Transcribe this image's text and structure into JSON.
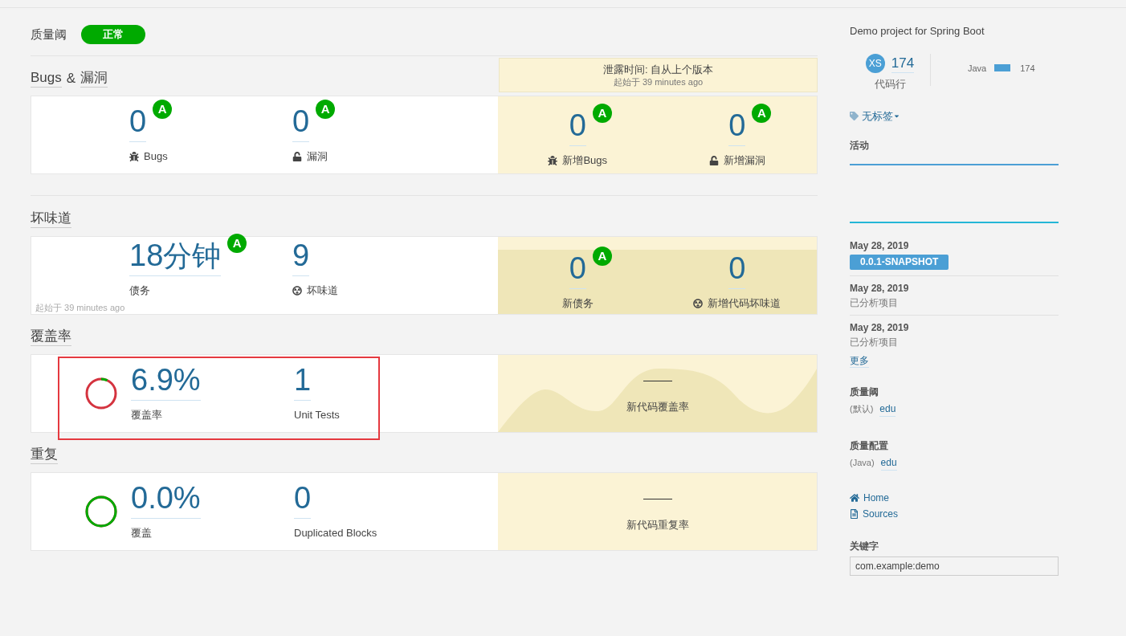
{
  "quality_gate": {
    "title": "质量阈",
    "status": "正常",
    "passed": true
  },
  "sections": [
    {
      "kind": "issues",
      "highlighted": false,
      "title": [
        {
          "text": "Bugs",
          "link": true
        },
        {
          "text": "&",
          "link": false
        },
        {
          "text": "漏洞",
          "link": true
        }
      ],
      "leak_header": {
        "title": "泄露时间: 自从上个版本",
        "since": "起始于 39 minutes ago"
      },
      "metrics": [
        {
          "value": "0",
          "rating": "A",
          "label": "Bugs"
        },
        {
          "value": "0",
          "rating": "A",
          "label": "漏洞"
        }
      ],
      "new_metrics": [
        {
          "value": "0",
          "rating": "A",
          "label": "新增Bugs"
        },
        {
          "value": "0",
          "rating": "A",
          "label": "新增漏洞"
        }
      ]
    },
    {
      "kind": "debt",
      "highlighted": false,
      "title": [
        {
          "text": "坏味道",
          "link": true
        }
      ],
      "footnote": "起始于 39 minutes ago",
      "metrics": [
        {
          "value": "18",
          "unit": "分钟",
          "rating": "A",
          "label": "债务"
        },
        {
          "value": "9",
          "label": "坏味道"
        }
      ],
      "new_metrics": [
        {
          "value": "0",
          "rating": "A",
          "label": "新债务"
        },
        {
          "value": "0",
          "label": "新增代码坏味道"
        }
      ]
    },
    {
      "kind": "coverage",
      "highlighted": true,
      "title": [
        {
          "text": "覆盖率",
          "link": true
        }
      ],
      "gauge": {
        "level": 0.069
      },
      "metrics": [
        {
          "value": "6.9%",
          "label": "覆盖率"
        },
        {
          "value": "1",
          "label": "Unit Tests"
        }
      ],
      "new_metrics": [
        {
          "label": "新代码覆盖率"
        }
      ]
    },
    {
      "kind": "duplication",
      "highlighted": false,
      "title": [
        {
          "text": "重复",
          "link": true
        }
      ],
      "gauge": {
        "level": 1
      },
      "metrics": [
        {
          "value": "0.0%",
          "label": "覆盖"
        },
        {
          "value": "0",
          "label": "Duplicated Blocks"
        }
      ],
      "new_metrics": [
        {
          "label": "新代码重复率"
        }
      ]
    }
  ],
  "project": {
    "description": "Demo project for Spring Boot",
    "avatar": "XS",
    "loc": "174",
    "loc_label": "代码行",
    "languages": [
      {
        "name": "Java",
        "loc": "174"
      }
    ]
  },
  "tags": {
    "label": "无标签"
  },
  "activity": {
    "title": "活动",
    "events": [
      {
        "date": "May 28, 2019",
        "version": "0.0.1-SNAPSHOT"
      },
      {
        "date": "May 28, 2019",
        "text": "已分析项目"
      },
      {
        "date": "May 28, 2019",
        "text": "已分析项目"
      }
    ],
    "more": "更多"
  },
  "quality_gate_info": {
    "title": "质量阈",
    "qualifier": "(默认)",
    "link": "edu"
  },
  "quality_profile": {
    "title": "质量配置",
    "qualifier": "(Java)",
    "link": "edu"
  },
  "links": [
    {
      "label": "Home"
    },
    {
      "label": "Sources"
    }
  ],
  "key": {
    "title": "关键字",
    "value": "com.example:demo"
  }
}
